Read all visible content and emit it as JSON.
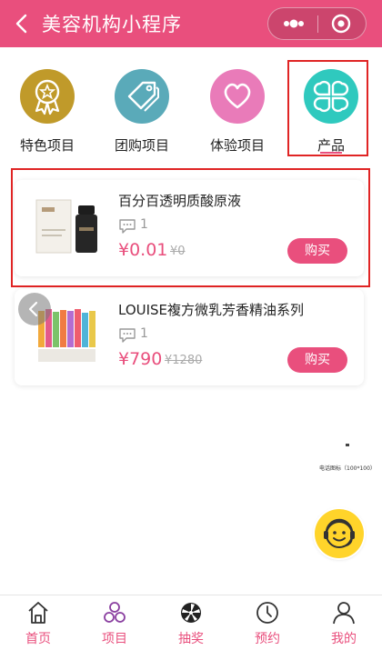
{
  "header": {
    "title": "美容机构小程序",
    "back_icon": "chevron-left-icon",
    "more_icon": "more-dots-icon",
    "close_icon": "target-circle-icon",
    "bg_color": "#e94f7d"
  },
  "categories": [
    {
      "label": "特色项目",
      "icon": "award-ribbon-icon",
      "color": "#c09a2a"
    },
    {
      "label": "团购项目",
      "icon": "price-tag-icon",
      "color": "#5aaab9"
    },
    {
      "label": "体验项目",
      "icon": "heart-icon",
      "color": "#e97bb9"
    },
    {
      "label": "产品",
      "icon": "clover-icon",
      "color": "#2fc9be",
      "selected": true
    }
  ],
  "products": [
    {
      "name": "百分百透明质酸原液",
      "comments": "1",
      "price": "¥0.01",
      "original_price": "¥0",
      "buy_label": "购买"
    },
    {
      "name": "LOUISE複方微乳芳香精油系列",
      "comments": "1",
      "price": "¥790",
      "original_price": "¥1280",
      "buy_label": "购买"
    }
  ],
  "floating": {
    "tiny_text": "电话图标（100*100）",
    "service_icon": "customer-service-smiley-icon",
    "prev_icon": "chevron-left-icon"
  },
  "tabbar": [
    {
      "label": "首页",
      "icon": "home-icon"
    },
    {
      "label": "项目",
      "icon": "project-circles-icon"
    },
    {
      "label": "抽奖",
      "icon": "lottery-wheel-icon"
    },
    {
      "label": "预约",
      "icon": "clock-icon"
    },
    {
      "label": "我的",
      "icon": "user-icon"
    }
  ],
  "colors": {
    "accent": "#e94f7d",
    "highlight_border": "#e02424"
  }
}
